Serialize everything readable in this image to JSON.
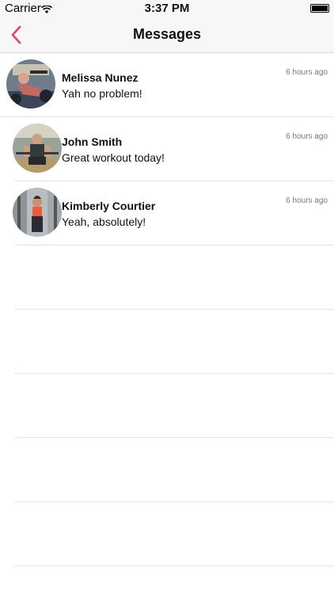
{
  "status_bar": {
    "carrier": "Carrier",
    "time": "3:37 PM",
    "battery_level": 1.0
  },
  "nav": {
    "title": "Messages",
    "back_icon": "chevron-left-icon",
    "accent_color": "#e0487a"
  },
  "messages": [
    {
      "name": "Melissa Nunez",
      "preview": "Yah no problem!",
      "timestamp": "6 hours ago",
      "avatar": "photo-avatar"
    },
    {
      "name": "John  Smith",
      "preview": "Great workout today!",
      "timestamp": "6 hours ago",
      "avatar": "photo-avatar"
    },
    {
      "name": "Kimberly  Courtier",
      "preview": "Yeah, absolutely!",
      "timestamp": "6 hours ago",
      "avatar": "photo-avatar"
    }
  ]
}
